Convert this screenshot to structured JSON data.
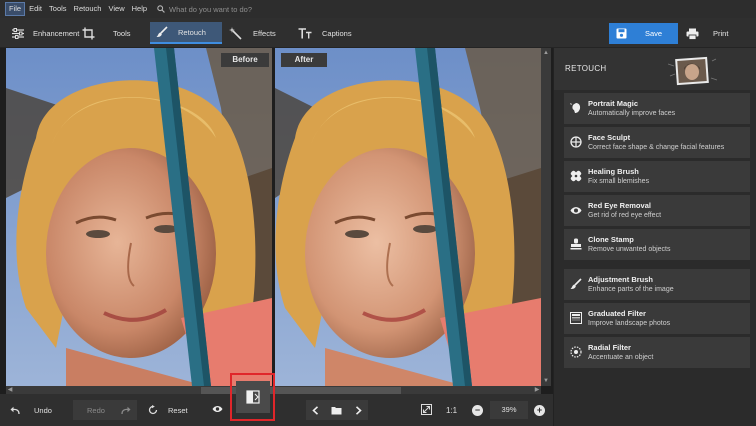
{
  "menu": {
    "items": [
      "File",
      "Edit",
      "Tools",
      "Retouch",
      "View",
      "Help"
    ],
    "search_placeholder": "What do you want to do?"
  },
  "toolbar": {
    "tabs": [
      {
        "label": "Enhancement",
        "icon": "sliders-icon"
      },
      {
        "label": "Tools",
        "icon": "crop-icon"
      },
      {
        "label": "Retouch",
        "icon": "brush-icon"
      },
      {
        "label": "Effects",
        "icon": "magic-wand-icon"
      },
      {
        "label": "Captions",
        "icon": "text-icon"
      }
    ],
    "active_tab": "Retouch",
    "save_label": "Save",
    "print_label": "Print"
  },
  "canvas": {
    "before_label": "Before",
    "after_label": "After"
  },
  "bottom": {
    "undo_label": "Undo",
    "redo_label": "Redo",
    "reset_label": "Reset",
    "zoom_ratio_label": "1:1",
    "zoom_value": "39%"
  },
  "panel": {
    "title": "RETOUCH",
    "tools": [
      {
        "name": "Portrait Magic",
        "desc": "Automatically improve faces",
        "icon": "portrait-magic-icon"
      },
      {
        "name": "Face Sculpt",
        "desc": "Correct face shape & change facial features",
        "icon": "face-sculpt-icon"
      },
      {
        "name": "Healing Brush",
        "desc": "Fix small blemishes",
        "icon": "bandage-icon"
      },
      {
        "name": "Red Eye Removal",
        "desc": "Get rid of red eye effect",
        "icon": "eye-icon"
      },
      {
        "name": "Clone Stamp",
        "desc": "Remove unwanted objects",
        "icon": "stamp-icon"
      },
      {
        "name": "Adjustment Brush",
        "desc": "Enhance parts of the image",
        "icon": "brush-icon"
      },
      {
        "name": "Graduated Filter",
        "desc": "Improve landscape photos",
        "icon": "graduated-filter-icon"
      },
      {
        "name": "Radial Filter",
        "desc": "Accentuate an object",
        "icon": "radial-filter-icon"
      }
    ]
  },
  "colors": {
    "accent": "#2e7fd6",
    "active_tab": "#3e5878",
    "highlight_border": "#e0262a"
  }
}
